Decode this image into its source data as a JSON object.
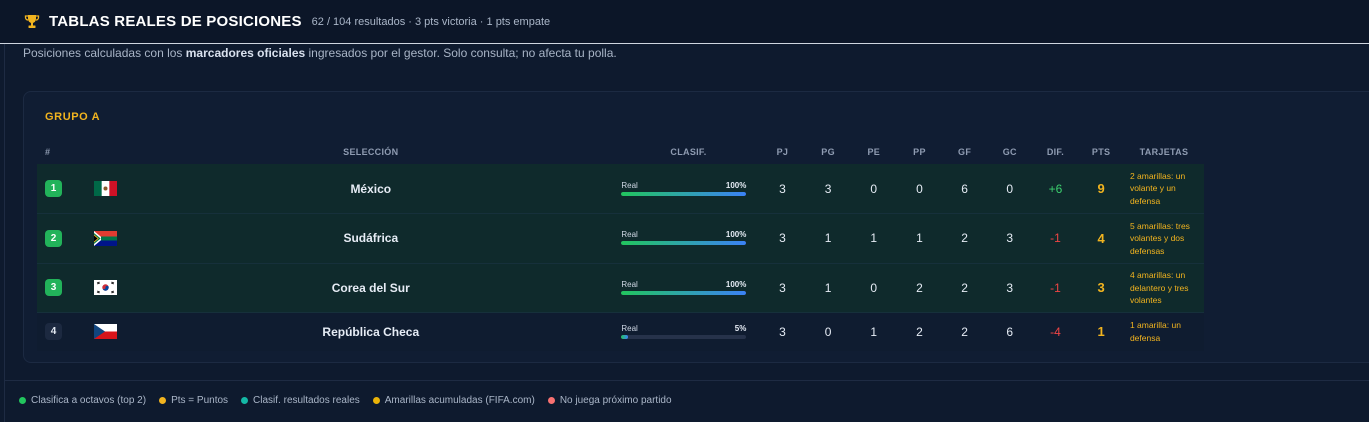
{
  "header": {
    "icon": "trophy-icon",
    "title": "TABLAS REALES DE POSICIONES",
    "meta": "62 / 104 resultados · 3 pts victoria · 1 pts empate"
  },
  "subtitle": {
    "before": "Posiciones calculadas con los ",
    "bold": "marcadores oficiales",
    "after": " ingresados por el gestor. Solo consulta; no afecta tu polla."
  },
  "group": {
    "title": "GRUPO A",
    "columns": {
      "pos": "#",
      "team": "SELECCIÓN",
      "clasif": "CLASIF.",
      "pj": "PJ",
      "pg": "PG",
      "pe": "PE",
      "pp": "PP",
      "gf": "GF",
      "gc": "GC",
      "dif": "DIF.",
      "pts": "PTS",
      "cards": "TARJETAS"
    },
    "rows": [
      {
        "pos": "1",
        "flag": "mexico-flag",
        "team": "México",
        "clasif_label": "Real",
        "clasif_pct_text": "100%",
        "clasif_pct": 100,
        "pj": "3",
        "pg": "3",
        "pe": "0",
        "pp": "0",
        "gf": "6",
        "gc": "0",
        "dif": "+6",
        "pts": "9",
        "cards": "2 amarillas: un volante y un defensa"
      },
      {
        "pos": "2",
        "flag": "south-africa-flag",
        "team": "Sudáfrica",
        "clasif_label": "Real",
        "clasif_pct_text": "100%",
        "clasif_pct": 100,
        "pj": "3",
        "pg": "1",
        "pe": "1",
        "pp": "1",
        "gf": "2",
        "gc": "3",
        "dif": "-1",
        "pts": "4",
        "cards": "5 amarillas: tres volantes y dos defensas"
      },
      {
        "pos": "3",
        "flag": "korea-flag",
        "team": "Corea del Sur",
        "clasif_label": "Real",
        "clasif_pct_text": "100%",
        "clasif_pct": 100,
        "pj": "3",
        "pg": "1",
        "pe": "0",
        "pp": "2",
        "gf": "2",
        "gc": "3",
        "dif": "-1",
        "pts": "3",
        "cards": "4 amarillas: un delantero y tres volantes"
      },
      {
        "pos": "4",
        "flag": "czech-flag",
        "team": "República Checa",
        "clasif_label": "Real",
        "clasif_pct_text": "5%",
        "clasif_pct": 5,
        "pj": "3",
        "pg": "0",
        "pe": "1",
        "pp": "2",
        "gf": "2",
        "gc": "6",
        "dif": "-4",
        "pts": "1",
        "cards": "1 amarilla: un defensa"
      }
    ]
  },
  "legend": [
    {
      "label": "Clasifica a octavos (top 2)",
      "color": "#22c55e"
    },
    {
      "label": "Pts = Puntos",
      "color": "#f2b41f"
    },
    {
      "label": "Clasif. resultados reales",
      "color": "#14b8a6"
    },
    {
      "label": "Amarillas acumuladas (FIFA.com)",
      "color": "#eab308"
    },
    {
      "label": "No juega próximo partido",
      "color": "#f87171"
    }
  ],
  "colors": {
    "accent": "#f2b41f",
    "positive": "#3ccf6e",
    "negative": "#ef4444",
    "qualify": "#22b35a"
  }
}
